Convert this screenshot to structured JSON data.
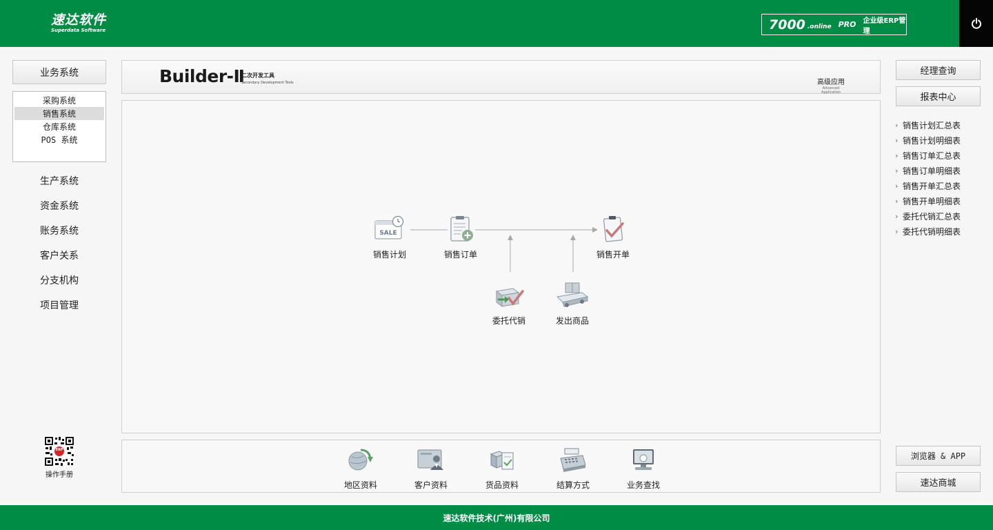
{
  "header": {
    "brand_cn": "速达软件",
    "brand_en": "Superdata Software",
    "product_number": "7000",
    "product_online": ".online",
    "product_pro": "PRO",
    "product_desc": "企业级ERP管理",
    "power_icon": "power-icon"
  },
  "left": {
    "top_button": "业务系统",
    "submenu": [
      {
        "label": "采购系统",
        "active": false
      },
      {
        "label": "销售系统",
        "active": true
      },
      {
        "label": "仓库系统",
        "active": false
      },
      {
        "label": "POS 系统",
        "active": false
      }
    ],
    "items": [
      "生产系统",
      "资金系统",
      "账务系统",
      "客户关系",
      "分支机构",
      "项目管理"
    ],
    "qr_label": "操作手册",
    "qr_badge": "ERP"
  },
  "banner": {
    "logo": "Builder-Ⅱ",
    "sub_cn": "二次开发工具",
    "sub_en": "Secondary Development Tools",
    "adv_cn": "高级应用",
    "adv_en": "Advanced Application"
  },
  "flow": {
    "nodes": [
      {
        "label": "销售计划",
        "icon": "sale-calendar-icon",
        "icon_text": "SALE"
      },
      {
        "label": "销售订单",
        "icon": "clipboard-plus-icon"
      },
      {
        "label": "销售开单",
        "icon": "clipboard-check-icon"
      },
      {
        "label": "委托代销",
        "icon": "box-arrow-check-icon"
      },
      {
        "label": "发出商品",
        "icon": "truck-box-icon"
      }
    ]
  },
  "tools": [
    {
      "label": "地区资料",
      "icon": "globe-arrow-icon"
    },
    {
      "label": "客户资料",
      "icon": "customer-card-icon"
    },
    {
      "label": "货品资料",
      "icon": "goods-box-icon"
    },
    {
      "label": "结算方式",
      "icon": "cash-register-icon"
    },
    {
      "label": "业务查找",
      "icon": "monitor-search-icon"
    }
  ],
  "right": {
    "manager_query": "经理查询",
    "report_center": "报表中心",
    "reports": [
      "销售计划汇总表",
      "销售计划明细表",
      "销售订单汇总表",
      "销售订单明细表",
      "销售开单汇总表",
      "销售开单明细表",
      "委托代销汇总表",
      "委托代销明细表"
    ],
    "browser_app": "浏览器 & APP",
    "shop": "速达商城"
  },
  "footer": {
    "company": "速达软件技术(广州)有限公司"
  },
  "colors": {
    "brand_green": "#008c45",
    "power_bg": "#050505"
  }
}
